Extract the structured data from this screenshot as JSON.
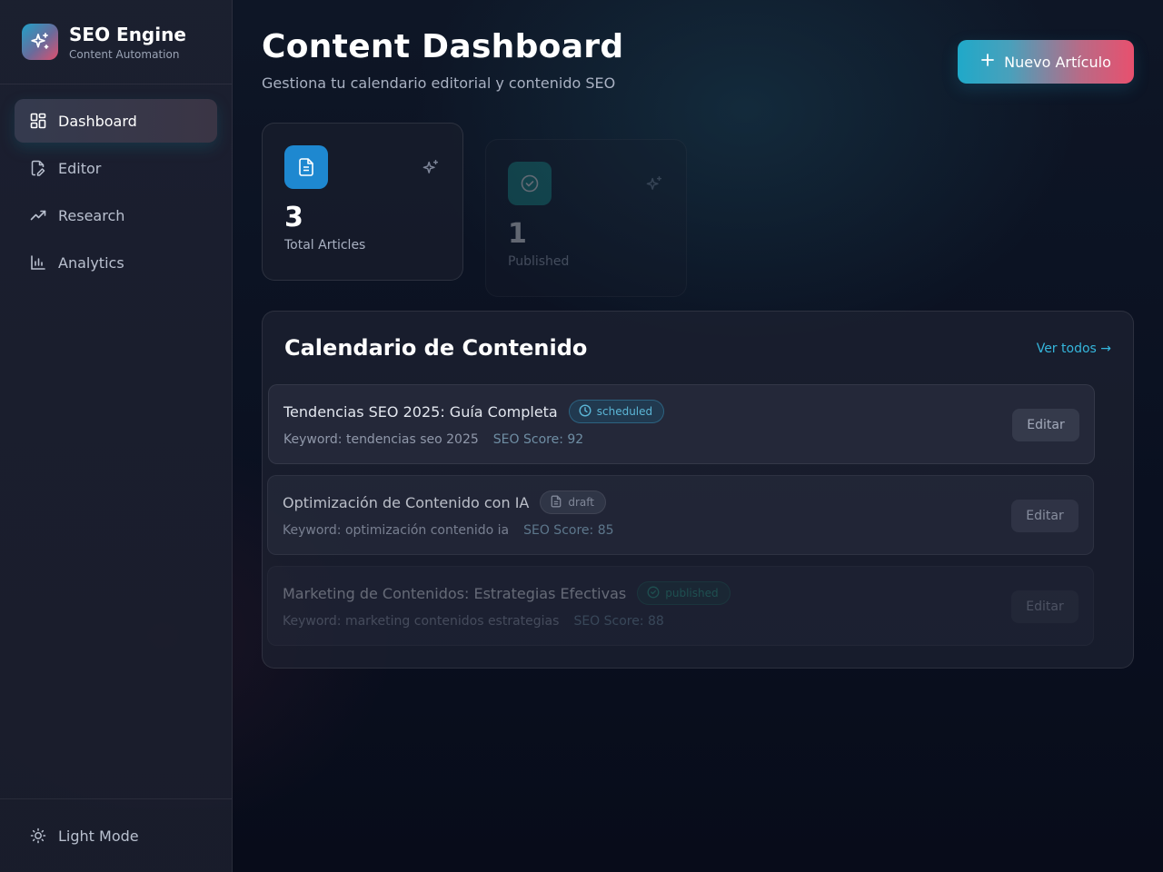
{
  "brand": {
    "name": "SEO Engine",
    "subtitle": "Content Automation",
    "logo_icon": "sparkles-icon"
  },
  "sidebar": {
    "items": [
      {
        "label": "Dashboard",
        "icon": "dashboard-icon",
        "active": true
      },
      {
        "label": "Editor",
        "icon": "file-edit-icon",
        "active": false
      },
      {
        "label": "Research",
        "icon": "trending-up-icon",
        "active": false
      },
      {
        "label": "Analytics",
        "icon": "bar-chart-icon",
        "active": false
      }
    ],
    "footer": {
      "label": "Light Mode",
      "icon": "sun-icon"
    }
  },
  "header": {
    "title": "Content Dashboard",
    "subtitle": "Gestiona tu calendario editorial y contenido SEO",
    "new_button": "Nuevo Artículo"
  },
  "stats": [
    {
      "value": "3",
      "label": "Total Articles",
      "icon": "document-icon",
      "color": "#1e88d0"
    },
    {
      "value": "1",
      "label": "Published",
      "icon": "check-circle-icon",
      "color": "#1b8f8a"
    }
  ],
  "calendar": {
    "title": "Calendario de Contenido",
    "view_all": "Ver todos →",
    "articles": [
      {
        "title": "Tendencias SEO 2025: Guía Completa",
        "status": "scheduled",
        "keyword": "Keyword: tendencias seo 2025",
        "score": "SEO Score: 92",
        "edit": "Editar"
      },
      {
        "title": "Optimización de Contenido con IA",
        "status": "draft",
        "keyword": "Keyword: optimización contenido ia",
        "score": "SEO Score: 85",
        "edit": "Editar"
      },
      {
        "title": "Marketing de Contenidos: Estrategias Efectivas",
        "status": "published",
        "keyword": "Keyword: marketing contenidos estrategias",
        "score": "SEO Score: 88",
        "edit": "Editar"
      }
    ]
  },
  "colors": {
    "accent_cyan": "#1fa9c9",
    "accent_pink": "#e8506e",
    "link": "#35b6dc"
  }
}
